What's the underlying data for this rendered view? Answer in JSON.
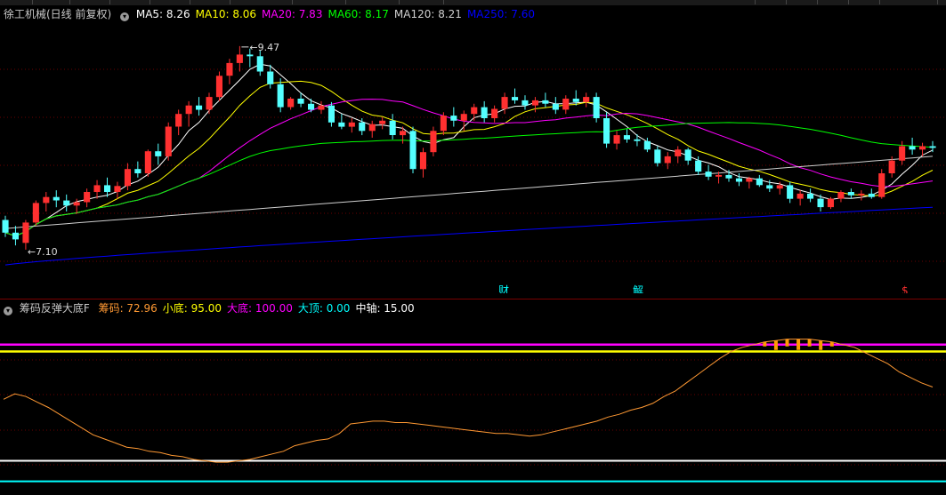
{
  "stock": {
    "title": "徐工机械(日线 前复权)",
    "ma_labels": [
      {
        "text": "MA5: 8.26",
        "color": "#ffffff"
      },
      {
        "text": "MA10: 8.06",
        "color": "#ffff00"
      },
      {
        "text": "MA20: 7.83",
        "color": "#ff00ff"
      },
      {
        "text": "MA60: 8.17",
        "color": "#00ff00"
      },
      {
        "text": "MA120: 8.21",
        "color": "#cfcfcf"
      },
      {
        "text": "MA250: 7.60",
        "color": "#0000ff"
      }
    ],
    "high_label": "9.47",
    "low_label": "7.10",
    "events": [
      {
        "text": "财",
        "color": "#00ffff"
      },
      {
        "text": "解",
        "color": "#00ffff"
      },
      {
        "text": "$",
        "color": "#ff3030"
      }
    ]
  },
  "indicator": {
    "title": "筹码反弹大底F",
    "labels": [
      {
        "text": "筹码: 72.96",
        "color": "#ff9933"
      },
      {
        "text": "小底: 95.00",
        "color": "#ffff00"
      },
      {
        "text": "大底: 100.00",
        "color": "#ff00ff"
      },
      {
        "text": "大顶: 0.00",
        "color": "#00ffff"
      },
      {
        "text": "中轴: 15.00",
        "color": "#ffffff"
      }
    ]
  },
  "chart_data": [
    {
      "type": "candlestick",
      "title": "徐工机械(日线 前复权)",
      "y_range": [
        6.9,
        9.75
      ],
      "y_labels_printed": {
        "high": 9.47,
        "low": 7.1
      },
      "up_color": "#ff3030",
      "down_color": "#54ffff",
      "series": [
        {
          "name": "MA5",
          "color": "#ffffff"
        },
        {
          "name": "MA10",
          "color": "#ffff00"
        },
        {
          "name": "MA20",
          "color": "#ff00ff"
        },
        {
          "name": "MA60",
          "color": "#00ff00"
        },
        {
          "name": "MA120",
          "color": "#cfcfcf"
        },
        {
          "name": "MA250",
          "color": "#0000ff"
        }
      ],
      "ohlc": [
        [
          7.45,
          7.5,
          7.25,
          7.3
        ],
        [
          7.3,
          7.38,
          7.15,
          7.22
        ],
        [
          7.18,
          7.45,
          7.1,
          7.42
        ],
        [
          7.42,
          7.68,
          7.38,
          7.65
        ],
        [
          7.65,
          7.78,
          7.55,
          7.72
        ],
        [
          7.72,
          7.8,
          7.6,
          7.68
        ],
        [
          7.68,
          7.75,
          7.55,
          7.62
        ],
        [
          7.62,
          7.7,
          7.52,
          7.66
        ],
        [
          7.66,
          7.82,
          7.6,
          7.78
        ],
        [
          7.78,
          7.92,
          7.7,
          7.86
        ],
        [
          7.86,
          7.95,
          7.72,
          7.78
        ],
        [
          7.78,
          7.9,
          7.7,
          7.85
        ],
        [
          7.85,
          8.12,
          7.8,
          8.05
        ],
        [
          8.05,
          8.14,
          7.95,
          8.0
        ],
        [
          8.0,
          8.28,
          7.96,
          8.26
        ],
        [
          8.26,
          8.35,
          8.1,
          8.2
        ],
        [
          8.2,
          8.6,
          8.15,
          8.55
        ],
        [
          8.55,
          8.75,
          8.45,
          8.7
        ],
        [
          8.7,
          8.85,
          8.55,
          8.8
        ],
        [
          8.8,
          8.9,
          8.68,
          8.75
        ],
        [
          8.75,
          8.95,
          8.7,
          8.9
        ],
        [
          8.9,
          9.2,
          8.85,
          9.15
        ],
        [
          9.15,
          9.35,
          9.05,
          9.3
        ],
        [
          9.3,
          9.5,
          9.2,
          9.4
        ],
        [
          9.4,
          9.47,
          9.25,
          9.38
        ],
        [
          9.38,
          9.45,
          9.15,
          9.2
        ],
        [
          9.2,
          9.28,
          9.0,
          9.05
        ],
        [
          9.05,
          9.12,
          8.72,
          8.78
        ],
        [
          8.78,
          8.9,
          8.75,
          8.88
        ],
        [
          8.88,
          8.95,
          8.78,
          8.82
        ],
        [
          8.82,
          8.88,
          8.72,
          8.75
        ],
        [
          8.75,
          8.85,
          8.7,
          8.8
        ],
        [
          8.8,
          8.84,
          8.55,
          8.6
        ],
        [
          8.6,
          8.7,
          8.52,
          8.55
        ],
        [
          8.55,
          8.65,
          8.48,
          8.6
        ],
        [
          8.6,
          8.65,
          8.45,
          8.5
        ],
        [
          8.5,
          8.62,
          8.42,
          8.58
        ],
        [
          8.58,
          8.66,
          8.52,
          8.62
        ],
        [
          8.62,
          8.7,
          8.4,
          8.45
        ],
        [
          8.45,
          8.55,
          8.35,
          8.5
        ],
        [
          8.5,
          8.55,
          8.0,
          8.05
        ],
        [
          8.05,
          8.3,
          7.95,
          8.25
        ],
        [
          8.25,
          8.55,
          8.2,
          8.5
        ],
        [
          8.5,
          8.72,
          8.45,
          8.68
        ],
        [
          8.68,
          8.78,
          8.55,
          8.62
        ],
        [
          8.62,
          8.74,
          8.5,
          8.7
        ],
        [
          8.7,
          8.82,
          8.62,
          8.78
        ],
        [
          8.78,
          8.85,
          8.6,
          8.65
        ],
        [
          8.65,
          8.8,
          8.6,
          8.76
        ],
        [
          8.76,
          8.95,
          8.7,
          8.9
        ],
        [
          8.9,
          9.0,
          8.82,
          8.86
        ],
        [
          8.86,
          8.92,
          8.75,
          8.8
        ],
        [
          8.8,
          8.9,
          8.72,
          8.86
        ],
        [
          8.86,
          8.95,
          8.78,
          8.82
        ],
        [
          8.82,
          8.9,
          8.7,
          8.75
        ],
        [
          8.75,
          8.92,
          8.7,
          8.88
        ],
        [
          8.88,
          8.98,
          8.8,
          8.84
        ],
        [
          8.84,
          8.95,
          8.78,
          8.9
        ],
        [
          8.9,
          8.95,
          8.6,
          8.65
        ],
        [
          8.65,
          8.72,
          8.3,
          8.35
        ],
        [
          8.35,
          8.5,
          8.28,
          8.45
        ],
        [
          8.45,
          8.52,
          8.36,
          8.4
        ],
        [
          8.4,
          8.46,
          8.32,
          8.38
        ],
        [
          8.38,
          8.42,
          8.25,
          8.28
        ],
        [
          8.28,
          8.32,
          8.08,
          8.12
        ],
        [
          8.12,
          8.25,
          8.05,
          8.2
        ],
        [
          8.2,
          8.32,
          8.12,
          8.28
        ],
        [
          8.28,
          8.3,
          8.1,
          8.15
        ],
        [
          8.15,
          8.2,
          7.98,
          8.02
        ],
        [
          8.02,
          8.1,
          7.92,
          7.96
        ],
        [
          7.96,
          8.02,
          7.88,
          7.98
        ],
        [
          7.98,
          8.04,
          7.9,
          7.94
        ],
        [
          7.94,
          8.0,
          7.85,
          7.9
        ],
        [
          7.9,
          7.96,
          7.82,
          7.94
        ],
        [
          7.94,
          7.98,
          7.84,
          7.86
        ],
        [
          7.86,
          7.92,
          7.78,
          7.82
        ],
        [
          7.82,
          7.9,
          7.75,
          7.86
        ],
        [
          7.86,
          7.9,
          7.65,
          7.7
        ],
        [
          7.7,
          7.8,
          7.62,
          7.76
        ],
        [
          7.76,
          7.82,
          7.66,
          7.7
        ],
        [
          7.7,
          7.75,
          7.55,
          7.6
        ],
        [
          7.6,
          7.72,
          7.58,
          7.7
        ],
        [
          7.7,
          7.8,
          7.66,
          7.78
        ],
        [
          7.78,
          7.82,
          7.7,
          7.74
        ],
        [
          7.74,
          7.8,
          7.68,
          7.76
        ],
        [
          7.76,
          7.82,
          7.7,
          7.72
        ],
        [
          7.72,
          8.05,
          7.7,
          8.0
        ],
        [
          8.0,
          8.2,
          7.95,
          8.15
        ],
        [
          8.15,
          8.38,
          8.1,
          8.32
        ],
        [
          8.32,
          8.42,
          8.22,
          8.28
        ],
        [
          8.28,
          8.36,
          8.2,
          8.32
        ],
        [
          8.32,
          8.38,
          8.25,
          8.3
        ]
      ]
    },
    {
      "type": "line",
      "title": "筹码反弹大底F",
      "y_range": [
        -10,
        120
      ],
      "reference_lines": [
        {
          "name": "大底",
          "value": 100.0,
          "color": "#ff00ff"
        },
        {
          "name": "小底",
          "value": 95.0,
          "color": "#ffff00"
        },
        {
          "name": "中轴",
          "value": 15.0,
          "color": "#ffffff"
        },
        {
          "name": "大顶",
          "value": 0.0,
          "color": "#00ffff"
        }
      ],
      "series": [
        {
          "name": "筹码",
          "color": "#ff9933",
          "values": [
            60,
            64,
            62,
            58,
            54,
            49,
            44,
            39,
            34,
            31,
            28,
            25,
            24,
            22,
            21,
            19,
            18,
            16,
            15,
            14,
            14,
            15,
            16,
            18,
            20,
            22,
            26,
            28,
            30,
            31,
            35,
            42,
            43,
            44,
            44,
            43,
            43,
            42,
            41,
            40,
            39,
            38,
            37,
            36,
            35,
            35,
            34,
            33,
            34,
            36,
            38,
            40,
            42,
            44,
            47,
            49,
            52,
            54,
            57,
            62,
            66,
            72,
            78,
            84,
            90,
            95,
            98,
            100,
            102,
            103,
            104,
            104,
            104,
            103,
            102,
            100,
            98,
            94,
            90,
            86,
            80,
            76,
            72,
            69
          ]
        }
      ],
      "band_fill_color": "#ff9900"
    }
  ]
}
